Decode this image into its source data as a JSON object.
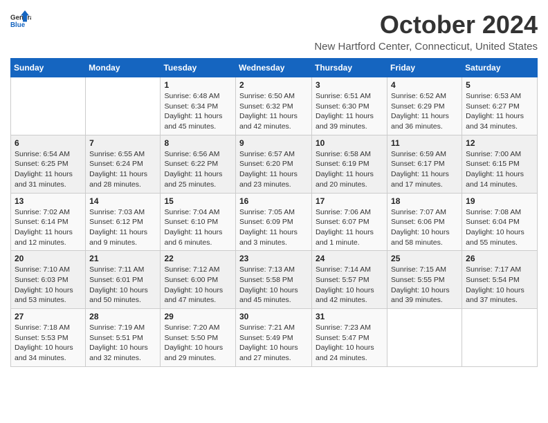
{
  "header": {
    "logo_line1": "General",
    "logo_line2": "Blue",
    "month_title": "October 2024",
    "location": "New Hartford Center, Connecticut, United States"
  },
  "days_of_week": [
    "Sunday",
    "Monday",
    "Tuesday",
    "Wednesday",
    "Thursday",
    "Friday",
    "Saturday"
  ],
  "weeks": [
    [
      {
        "day": "",
        "info": ""
      },
      {
        "day": "",
        "info": ""
      },
      {
        "day": "1",
        "info": "Sunrise: 6:48 AM\nSunset: 6:34 PM\nDaylight: 11 hours and 45 minutes."
      },
      {
        "day": "2",
        "info": "Sunrise: 6:50 AM\nSunset: 6:32 PM\nDaylight: 11 hours and 42 minutes."
      },
      {
        "day": "3",
        "info": "Sunrise: 6:51 AM\nSunset: 6:30 PM\nDaylight: 11 hours and 39 minutes."
      },
      {
        "day": "4",
        "info": "Sunrise: 6:52 AM\nSunset: 6:29 PM\nDaylight: 11 hours and 36 minutes."
      },
      {
        "day": "5",
        "info": "Sunrise: 6:53 AM\nSunset: 6:27 PM\nDaylight: 11 hours and 34 minutes."
      }
    ],
    [
      {
        "day": "6",
        "info": "Sunrise: 6:54 AM\nSunset: 6:25 PM\nDaylight: 11 hours and 31 minutes."
      },
      {
        "day": "7",
        "info": "Sunrise: 6:55 AM\nSunset: 6:24 PM\nDaylight: 11 hours and 28 minutes."
      },
      {
        "day": "8",
        "info": "Sunrise: 6:56 AM\nSunset: 6:22 PM\nDaylight: 11 hours and 25 minutes."
      },
      {
        "day": "9",
        "info": "Sunrise: 6:57 AM\nSunset: 6:20 PM\nDaylight: 11 hours and 23 minutes."
      },
      {
        "day": "10",
        "info": "Sunrise: 6:58 AM\nSunset: 6:19 PM\nDaylight: 11 hours and 20 minutes."
      },
      {
        "day": "11",
        "info": "Sunrise: 6:59 AM\nSunset: 6:17 PM\nDaylight: 11 hours and 17 minutes."
      },
      {
        "day": "12",
        "info": "Sunrise: 7:00 AM\nSunset: 6:15 PM\nDaylight: 11 hours and 14 minutes."
      }
    ],
    [
      {
        "day": "13",
        "info": "Sunrise: 7:02 AM\nSunset: 6:14 PM\nDaylight: 11 hours and 12 minutes."
      },
      {
        "day": "14",
        "info": "Sunrise: 7:03 AM\nSunset: 6:12 PM\nDaylight: 11 hours and 9 minutes."
      },
      {
        "day": "15",
        "info": "Sunrise: 7:04 AM\nSunset: 6:10 PM\nDaylight: 11 hours and 6 minutes."
      },
      {
        "day": "16",
        "info": "Sunrise: 7:05 AM\nSunset: 6:09 PM\nDaylight: 11 hours and 3 minutes."
      },
      {
        "day": "17",
        "info": "Sunrise: 7:06 AM\nSunset: 6:07 PM\nDaylight: 11 hours and 1 minute."
      },
      {
        "day": "18",
        "info": "Sunrise: 7:07 AM\nSunset: 6:06 PM\nDaylight: 10 hours and 58 minutes."
      },
      {
        "day": "19",
        "info": "Sunrise: 7:08 AM\nSunset: 6:04 PM\nDaylight: 10 hours and 55 minutes."
      }
    ],
    [
      {
        "day": "20",
        "info": "Sunrise: 7:10 AM\nSunset: 6:03 PM\nDaylight: 10 hours and 53 minutes."
      },
      {
        "day": "21",
        "info": "Sunrise: 7:11 AM\nSunset: 6:01 PM\nDaylight: 10 hours and 50 minutes."
      },
      {
        "day": "22",
        "info": "Sunrise: 7:12 AM\nSunset: 6:00 PM\nDaylight: 10 hours and 47 minutes."
      },
      {
        "day": "23",
        "info": "Sunrise: 7:13 AM\nSunset: 5:58 PM\nDaylight: 10 hours and 45 minutes."
      },
      {
        "day": "24",
        "info": "Sunrise: 7:14 AM\nSunset: 5:57 PM\nDaylight: 10 hours and 42 minutes."
      },
      {
        "day": "25",
        "info": "Sunrise: 7:15 AM\nSunset: 5:55 PM\nDaylight: 10 hours and 39 minutes."
      },
      {
        "day": "26",
        "info": "Sunrise: 7:17 AM\nSunset: 5:54 PM\nDaylight: 10 hours and 37 minutes."
      }
    ],
    [
      {
        "day": "27",
        "info": "Sunrise: 7:18 AM\nSunset: 5:53 PM\nDaylight: 10 hours and 34 minutes."
      },
      {
        "day": "28",
        "info": "Sunrise: 7:19 AM\nSunset: 5:51 PM\nDaylight: 10 hours and 32 minutes."
      },
      {
        "day": "29",
        "info": "Sunrise: 7:20 AM\nSunset: 5:50 PM\nDaylight: 10 hours and 29 minutes."
      },
      {
        "day": "30",
        "info": "Sunrise: 7:21 AM\nSunset: 5:49 PM\nDaylight: 10 hours and 27 minutes."
      },
      {
        "day": "31",
        "info": "Sunrise: 7:23 AM\nSunset: 5:47 PM\nDaylight: 10 hours and 24 minutes."
      },
      {
        "day": "",
        "info": ""
      },
      {
        "day": "",
        "info": ""
      }
    ]
  ]
}
